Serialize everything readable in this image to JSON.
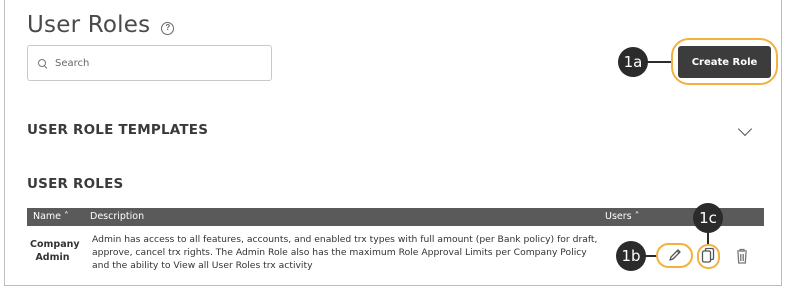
{
  "page": {
    "title": "User Roles",
    "help_icon": "?"
  },
  "search": {
    "placeholder": "Search",
    "icon": "search-icon"
  },
  "toolbar": {
    "create_label": "Create Role"
  },
  "callouts": {
    "a": "1a",
    "b": "1b",
    "c": "1c"
  },
  "sections": {
    "templates": "USER ROLE TEMPLATES",
    "roles": "USER ROLES"
  },
  "table": {
    "columns": {
      "name": "Name ˄",
      "description": "Description",
      "users": "Users ˄"
    },
    "rows": [
      {
        "name": "Company Admin",
        "description": "Admin has access to all features, accounts, and enabled trx types with full amount (per Bank policy) for draft, approve, cancel trx rights. The Admin Role also has the maximum Role Approval Limits per Company Policy and the ability to View all User Roles trx activity",
        "actions": [
          "pencil-icon",
          "copy-icon",
          "trash-icon"
        ]
      }
    ]
  },
  "colors": {
    "accent_ring": "#f3b13e",
    "button": "#3c3c3c",
    "table_header": "#5a5a5a"
  }
}
